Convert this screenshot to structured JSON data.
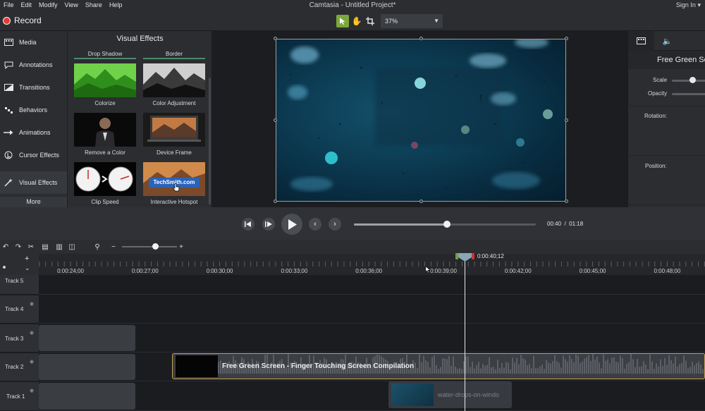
{
  "menu": {
    "items": [
      "File",
      "Edit",
      "Modify",
      "View",
      "Share",
      "Help"
    ]
  },
  "window": {
    "title": "Camtasia - Untitled Project*",
    "sign_in": "Sign In"
  },
  "toolbar": {
    "record_label": "Record",
    "zoom_value": "37%"
  },
  "sidebar": {
    "items": [
      {
        "label": "Media",
        "icon": "film-icon"
      },
      {
        "label": "Annotations",
        "icon": "speech-bubble-icon"
      },
      {
        "label": "Transitions",
        "icon": "transition-icon"
      },
      {
        "label": "Behaviors",
        "icon": "behaviors-icon"
      },
      {
        "label": "Animations",
        "icon": "arrow-right-icon"
      },
      {
        "label": "Cursor Effects",
        "icon": "cursor-icon"
      },
      {
        "label": "Visual Effects",
        "icon": "magic-wand-icon"
      }
    ],
    "active_index": 6,
    "more_label": "More"
  },
  "effects": {
    "title": "Visual Effects",
    "top_row": [
      "Drop Shadow",
      "Border"
    ],
    "cards": [
      {
        "label": "Colorize"
      },
      {
        "label": "Color Adjustment"
      },
      {
        "label": "Remove a Color"
      },
      {
        "label": "Device Frame"
      },
      {
        "label": "Clip Speed"
      },
      {
        "label": "Interactive Hotspot"
      }
    ],
    "hotspot_text": "TechSmith.com"
  },
  "properties": {
    "clip_name": "Free Green Screen",
    "scale_label": "Scale",
    "opacity_label": "Opacity",
    "rotation_label": "Rotation:",
    "position_label": "Position:"
  },
  "playback": {
    "current": "00:40",
    "separator": "/",
    "total": "01:18",
    "progress": 0.51
  },
  "timeline": {
    "playhead_time": "0:00:40;12",
    "ticks": [
      "0:00:24;00",
      "0:00:27;00",
      "0:00:30;00",
      "0:00:33;00",
      "0:00:36;00",
      "0:00:39;00",
      "0:00:42;00",
      "0:00:45;00",
      "0:00:48;00"
    ],
    "tracks": [
      "Track 5",
      "Track 4",
      "Track 3",
      "Track 2",
      "Track 1"
    ],
    "clip_main_title": "Free Green Screen - Finger Touching Screen Compilation",
    "clip_secondary_title": "water-drops-on-windo"
  }
}
